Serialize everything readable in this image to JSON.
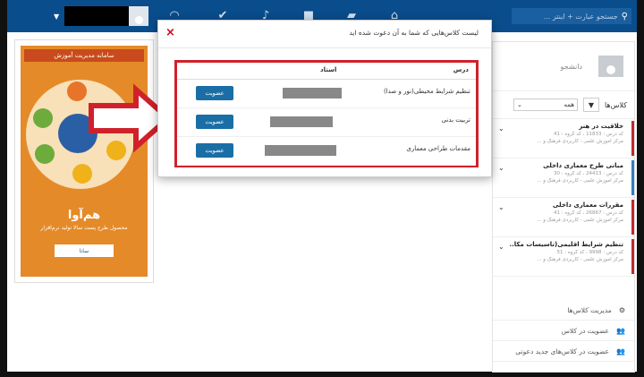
{
  "topbar": {
    "search_placeholder": "جستجو عبارت + اینتر ...",
    "icons": [
      "rss-icon",
      "check-icon",
      "bell-icon",
      "chat-icon",
      "book-icon",
      "home-icon"
    ]
  },
  "poster": {
    "title": "سامانه مدیریت آموزش",
    "brand": "هم‌آوا",
    "tagline": "محصول طرح پست سالا تولید نرم‌افزار",
    "logo_text": "سانا"
  },
  "modal": {
    "title": "لیست کلاس‌هایی که شما به آن دعوت شده اید",
    "close_label": "×",
    "col_course": "درس",
    "col_teacher": "استاد",
    "rows": [
      {
        "course": "تنظیم شرایط محیطی(نور و صدا)",
        "join_label": "عضویت"
      },
      {
        "course": "تربیت بدنی",
        "join_label": "عضویت"
      },
      {
        "course": "مقدمات طراحی معماری",
        "join_label": "عضویت"
      }
    ]
  },
  "profile": {
    "role": "دانشجو"
  },
  "classes": {
    "label": "کلاس‌ها",
    "filter_icon": "▼",
    "select_value": "همه",
    "items": [
      {
        "name": "خلاقیت در هنر",
        "meta1": "کد درس : 11833 ، کد گروه : 41",
        "meta2": "مرکز آموزش علمی - کاربردی فرهنگ و ...",
        "color": "#c0292c"
      },
      {
        "name": "مبانی طرح معماری داخلی",
        "meta1": "کد درس : 24413 ، کد گروه : 30",
        "meta2": "مرکز آموزش علمی - کاربردی فرهنگ و ...",
        "color": "#2f7fc1"
      },
      {
        "name": "مقررات معماری داخلی",
        "meta1": "کد درس : 26867 ، کد گروه : 41",
        "meta2": "مرکز آموزش علمی - کاربردی فرهنگ و ...",
        "color": "#c0292c"
      },
      {
        "name": "تنظیم شرایط اقلیمی(تاسیسات مکا...",
        "meta1": "کد درس : 9998 ، کد گروه : 51",
        "meta2": "مرکز آموزش علمی - کاربردی فرهنگ و ...",
        "color": "#c0292c"
      }
    ]
  },
  "actions": [
    {
      "label": "مدیریت کلاس‌ها",
      "icon": "gear-icon"
    },
    {
      "label": "عضویت در کلاس",
      "icon": "users-icon"
    },
    {
      "label": "عضویت در کلاس‌های جدید دعوتی",
      "icon": "users-icon"
    }
  ]
}
